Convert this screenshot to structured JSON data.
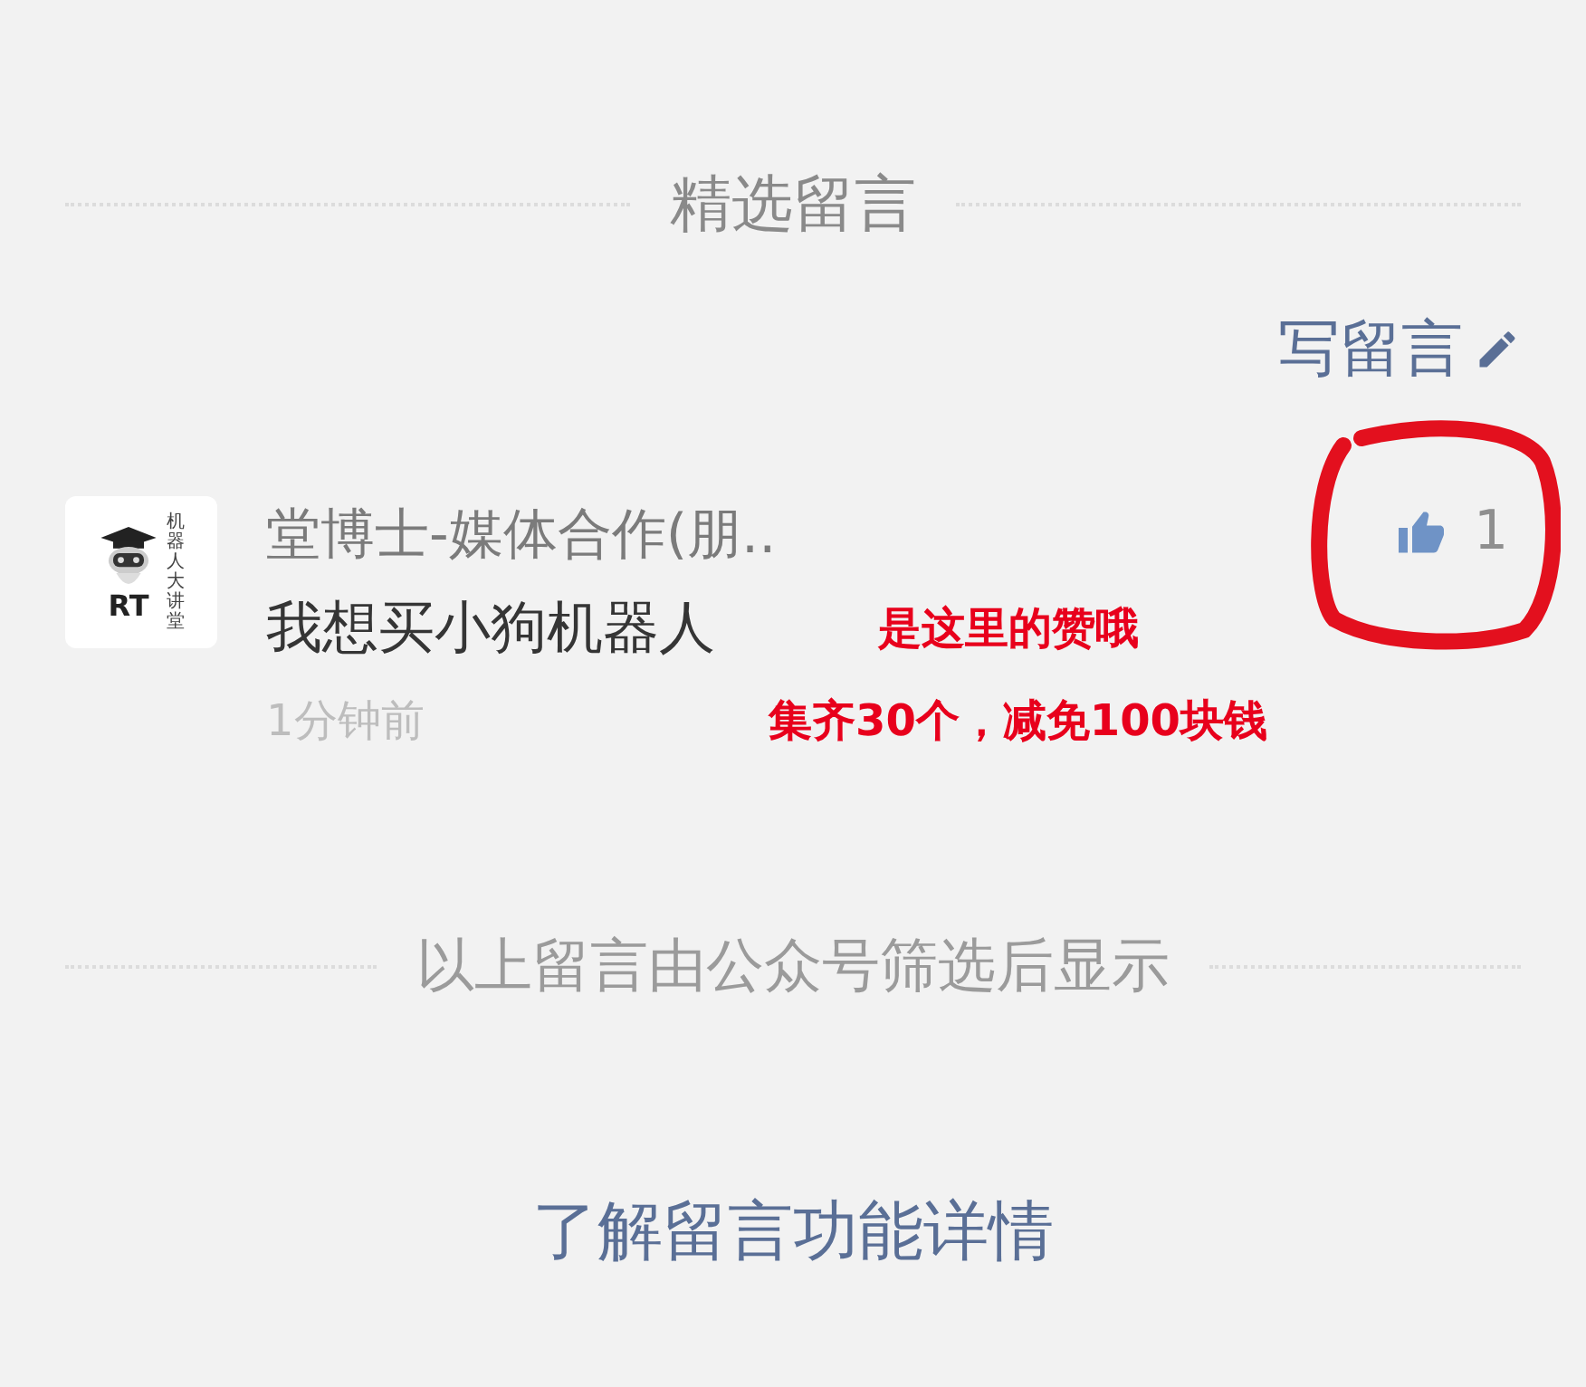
{
  "section_title": "精选留言",
  "write_link": "写留言",
  "comments": [
    {
      "avatar": {
        "logo_text": "RT",
        "side_text": "机器人大讲堂"
      },
      "name": "堂博士-媒体合作(朋..",
      "content": "我想买小狗机器人",
      "time": "1分钟前",
      "liked": true,
      "likes": "1"
    }
  ],
  "annotations": [
    {
      "text": "是这里的赞哦"
    },
    {
      "text": "集齐30个，减免100块钱"
    }
  ],
  "footer_note": "以上留言由公众号筛选后显示",
  "info_link": "了解留言功能详情"
}
